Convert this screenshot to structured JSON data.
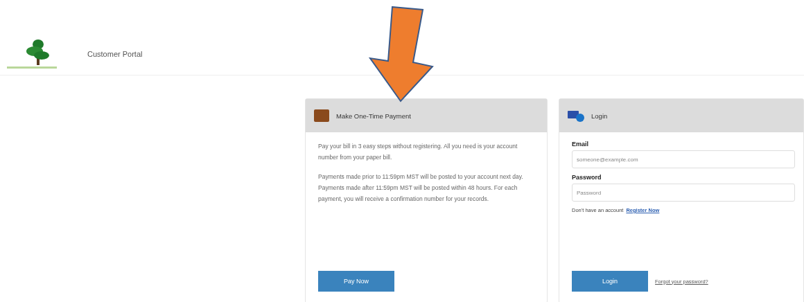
{
  "header": {
    "title": "Customer Portal"
  },
  "payment_card": {
    "title": "Make One-Time Payment",
    "paragraphs": [
      "Pay your bill in 3 easy steps without registering. All you need is your account number from your paper bill.",
      "Payments made prior to 11:59pm MST will be posted to your account next day. Payments made after 11:59pm MST will be posted within 48 hours. For each payment, you will receive a confirmation number for your records."
    ],
    "button": "Pay Now"
  },
  "login_card": {
    "title": "Login",
    "fields": [
      {
        "label": "Email",
        "placeholder": "someone@example.com"
      },
      {
        "label": "Password",
        "placeholder": "Password"
      }
    ],
    "register_prompt": "Don't have an account",
    "register_link": "Register Now",
    "button": "Login",
    "forgot_link": "Forgot your password?"
  }
}
